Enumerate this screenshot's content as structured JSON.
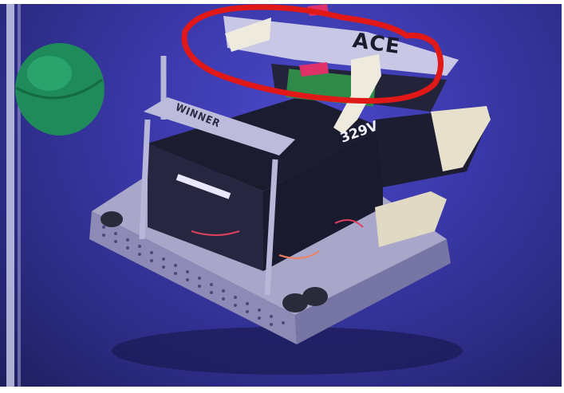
{
  "image": {
    "plate_top_text": "ACE",
    "plate_front_text": "WINNER",
    "team_number": "329V",
    "annotation_color": "#e01818",
    "ball_color": "#1f8a5a"
  }
}
